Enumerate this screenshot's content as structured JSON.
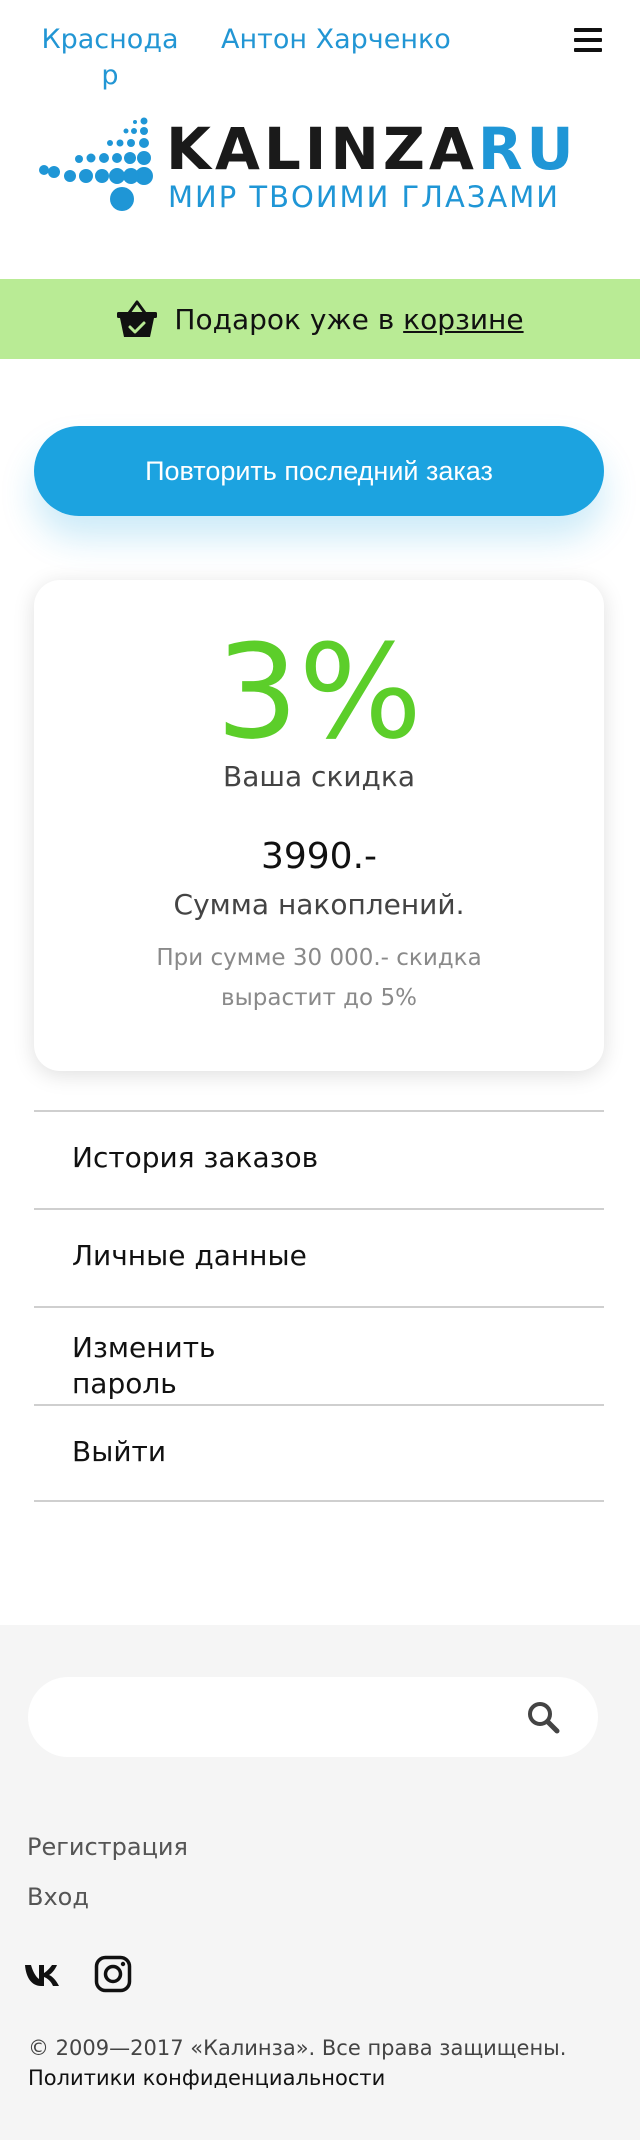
{
  "header": {
    "city": "Краснодар",
    "user_name": "Антон Харченко"
  },
  "logo": {
    "title_main": "KALINZA",
    "title_accent": "RU",
    "tagline": "МИР ТВОИМИ ГЛАЗАМИ"
  },
  "gift_bar": {
    "text": "Подарок уже в ",
    "link": "корзине"
  },
  "repeat_button": "Повторить последний заказ",
  "discount_card": {
    "percent": "3%",
    "discount_label": "Ваша скидка",
    "sum": "3990.-",
    "sum_label": "Сумма накоплений.",
    "hint": "При сумме 30 000.-  скидка вырастит до 5%"
  },
  "menu": {
    "items": [
      {
        "label": "История заказов"
      },
      {
        "label": "Личные данные"
      },
      {
        "label": "Изменить пароль"
      },
      {
        "label": "Выйти"
      }
    ]
  },
  "footer": {
    "search_placeholder": "",
    "register": "Регистрация",
    "login": "Вход",
    "copyright": "© 2009—2017 «Калинза». Все права защищены.",
    "privacy": "Политики конфиденциальности"
  },
  "colors": {
    "accent": "#1ca3e0",
    "link": "#2296d4",
    "discount": "#5cce2a",
    "gift_bar": "#b9eb95"
  },
  "icons": {
    "menu": "hamburger-icon",
    "basket": "basket-icon",
    "search": "search-icon",
    "vk": "vk-icon",
    "instagram": "instagram-icon"
  }
}
